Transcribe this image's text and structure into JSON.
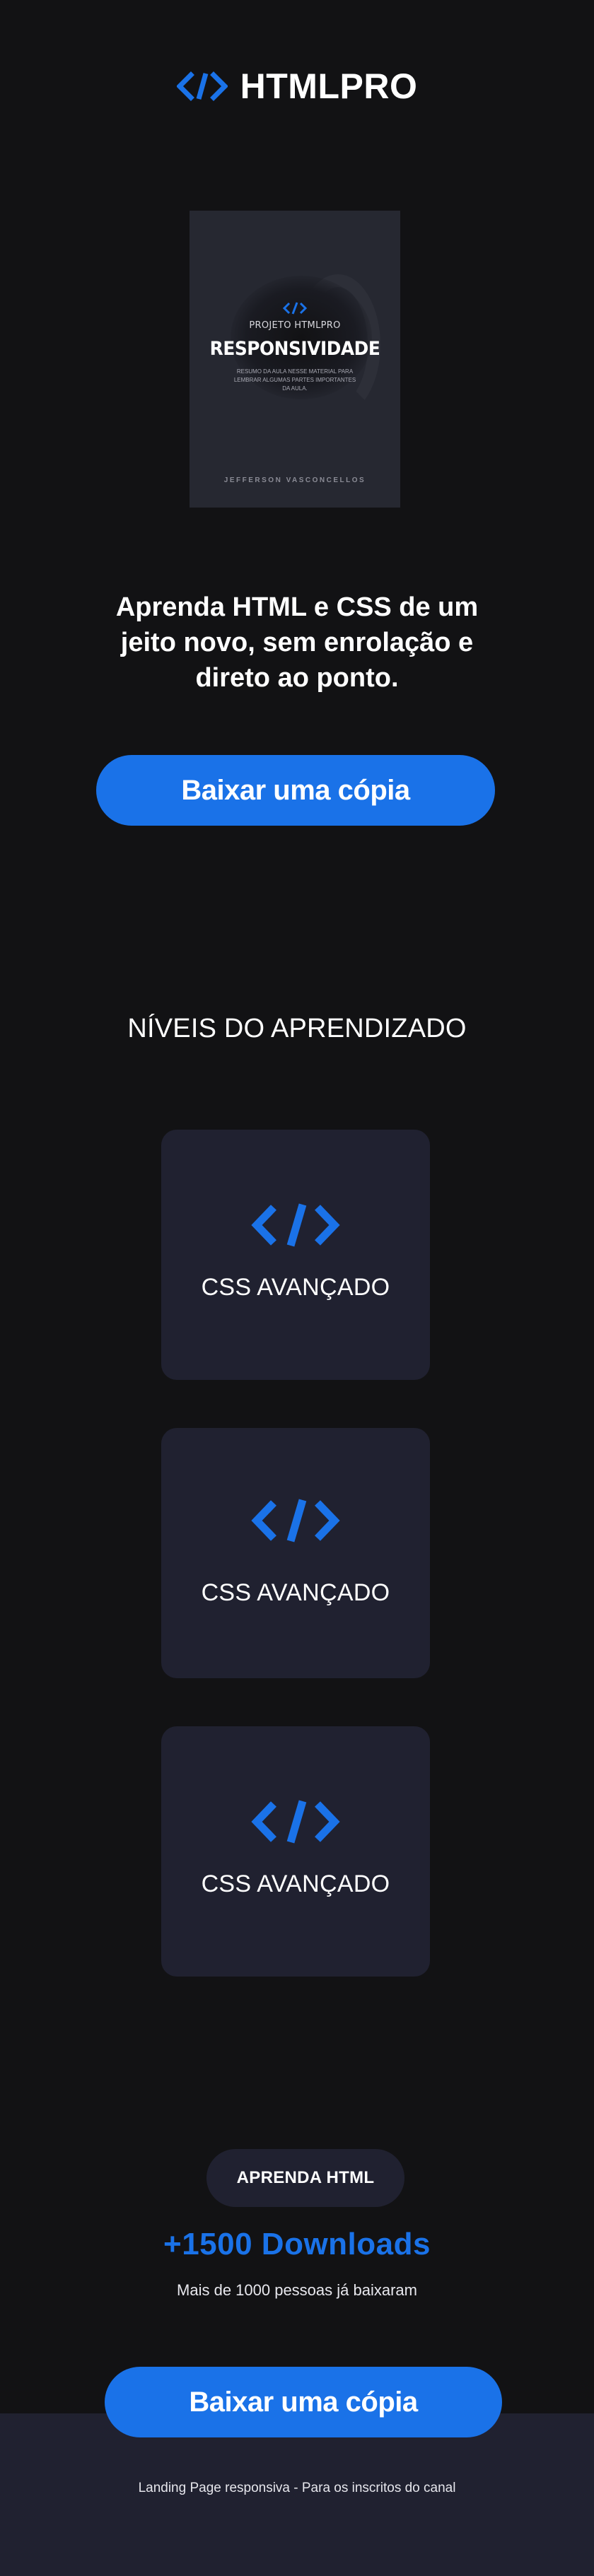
{
  "brand": {
    "logo_icon": "code-brackets-icon",
    "name": "HTMLPRO",
    "accent_color": "#1a72e8"
  },
  "book": {
    "icon": "code-brackets-icon",
    "series": "PROJETO HTMLPRO",
    "title": "RESPONSIVIDADE",
    "description": "RESUMO DA AULA NESSE MATERIAL PARA LEMBRAR ALGUMAS PARTES IMPORTANTES DA AULA.",
    "author": "JEFFERSON VASCONCELLOS"
  },
  "hero": {
    "headline": "Aprenda HTML e CSS de um jeito novo, sem enrolação e direto  ao ponto.",
    "cta_label": "Baixar uma cópia"
  },
  "levels": {
    "title": "NÍVEIS DO APRENDIZADO",
    "cards": [
      {
        "icon": "code-brackets-icon",
        "label": "CSS AVANÇADO"
      },
      {
        "icon": "code-brackets-icon",
        "label": "CSS AVANÇADO"
      },
      {
        "icon": "code-brackets-icon",
        "label": "CSS AVANÇADO"
      }
    ]
  },
  "downloads": {
    "badge": "APRENDA HTML",
    "count": "+1500 Downloads",
    "subtitle": "Mais de 1000 pessoas já baixaram",
    "cta_label": "Baixar uma cópia"
  },
  "footer": {
    "text": "Landing Page responsiva - Para os inscritos do canal"
  }
}
